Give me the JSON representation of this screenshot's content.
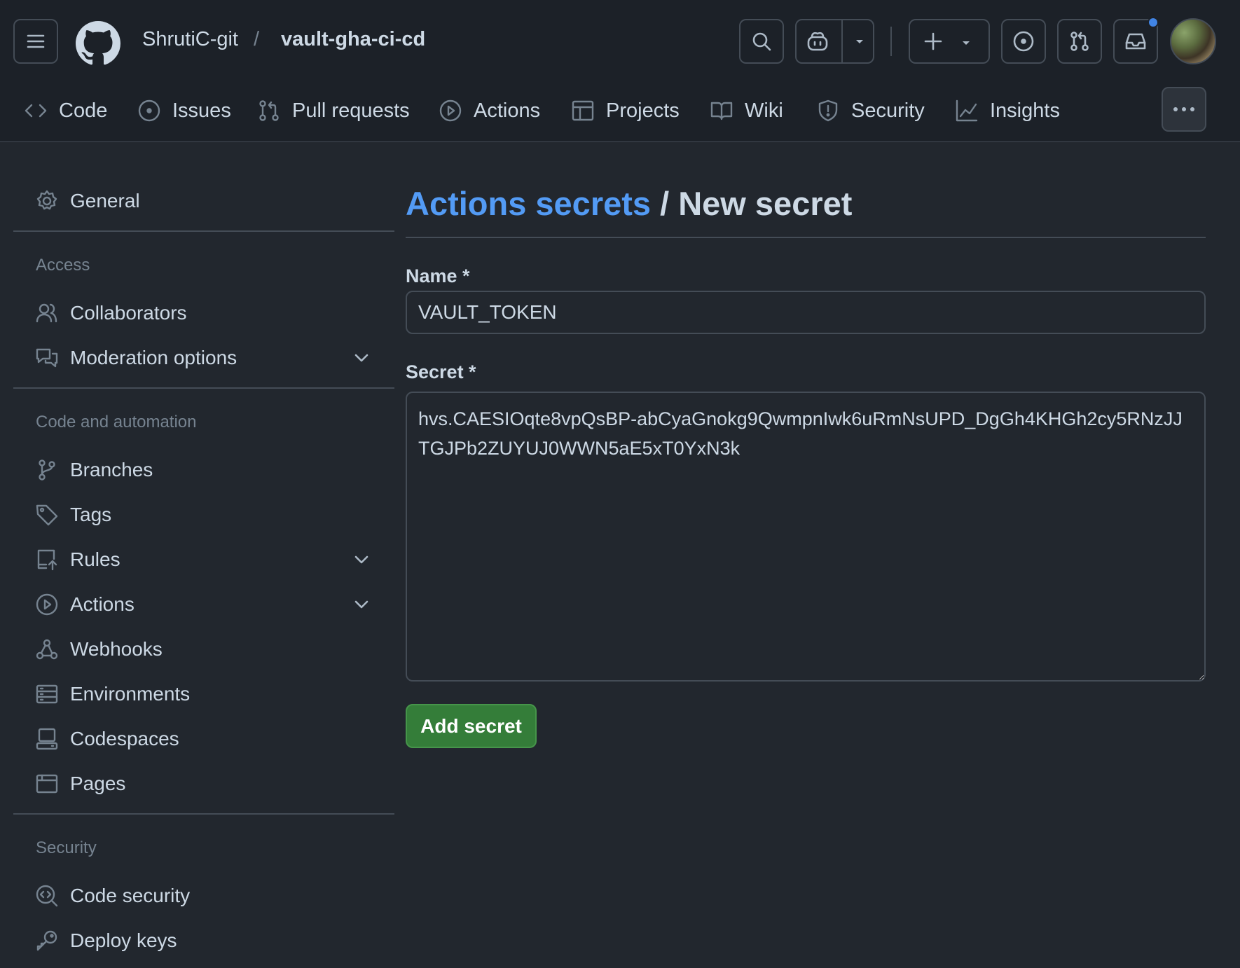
{
  "header": {
    "owner": "ShrutiC-git",
    "separator": "/",
    "repo": "vault-gha-ci-cd",
    "icons": {
      "menu": "hamburger-icon",
      "logo": "github-logo",
      "search": "search-icon",
      "copilot": "copilot-icon",
      "dropdown": "triangle-down-icon",
      "create": "plus-icon",
      "issues": "issue-opened-icon",
      "pulls": "git-pull-request-icon",
      "inbox": "inbox-icon"
    },
    "notification_color": "#4184e4"
  },
  "tabs": [
    {
      "label": "Code",
      "icon": "code-icon"
    },
    {
      "label": "Issues",
      "icon": "issue-opened-icon"
    },
    {
      "label": "Pull requests",
      "icon": "git-pull-request-icon"
    },
    {
      "label": "Actions",
      "icon": "play-icon"
    },
    {
      "label": "Projects",
      "icon": "table-icon"
    },
    {
      "label": "Wiki",
      "icon": "book-icon"
    },
    {
      "label": "Security",
      "icon": "shield-icon"
    },
    {
      "label": "Insights",
      "icon": "graph-icon"
    }
  ],
  "sidebar": {
    "general": "General",
    "groups": {
      "access": "Access",
      "code_automation": "Code and automation",
      "security": "Security"
    },
    "items": {
      "collaborators": "Collaborators",
      "moderation": "Moderation options",
      "branches": "Branches",
      "tags": "Tags",
      "rules": "Rules",
      "actions": "Actions",
      "webhooks": "Webhooks",
      "environments": "Environments",
      "codespaces": "Codespaces",
      "pages": "Pages",
      "code_security": "Code security",
      "deploy_keys": "Deploy keys"
    }
  },
  "main": {
    "breadcrumb_link": "Actions secrets",
    "breadcrumb_rest": "/ New secret",
    "name_label": "Name *",
    "name_value": "VAULT_TOKEN",
    "secret_label": "Secret *",
    "secret_value": "hvs.CAESIOqte8vpQsBP-abCyaGnokg9QwmpnIwk6uRmNsUPD_DgGh4KHGh2cy5RNzJJTGJPb2ZUYUJ0WWN5aE5xT0YxN3k",
    "submit": "Add secret",
    "accent": "#539bf5",
    "button_color": "#347d39"
  }
}
